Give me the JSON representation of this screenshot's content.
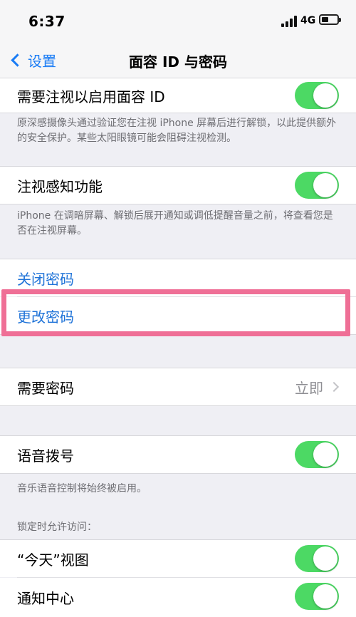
{
  "status": {
    "time": "6:37",
    "network": "4G"
  },
  "nav": {
    "back_label": "设置",
    "title": "面容 ID 与密码"
  },
  "attention_require": {
    "label": "需要注视以启用面容 ID",
    "on": true
  },
  "attention_require_note": "原深感摄像头通过验证您在注视 iPhone 屏幕后进行解锁，以此提供额外的安全保护。某些太阳眼镜可能会阻碍注视检测。",
  "attention_aware": {
    "label": "注视感知功能",
    "on": true
  },
  "attention_aware_note": "iPhone 在调暗屏幕、解锁后展开通知或调低提醒音量之前，将查看您是否在注视屏幕。",
  "passcode": {
    "turn_off": "关闭密码",
    "change": "更改密码"
  },
  "require_passcode": {
    "label": "需要密码",
    "value": "立即"
  },
  "voice_dial": {
    "label": "语音拨号",
    "on": true
  },
  "voice_dial_note": "音乐语音控制将始终被启用。",
  "locked_access_header": "锁定时允许访问：",
  "today_view": {
    "label": "“今天”视图",
    "on": true
  },
  "notification_center": {
    "label": "通知中心",
    "on": true
  },
  "colors": {
    "accent": "#1a7cf5",
    "toggle_on": "#4cd964",
    "highlight": "#ef6f96"
  }
}
